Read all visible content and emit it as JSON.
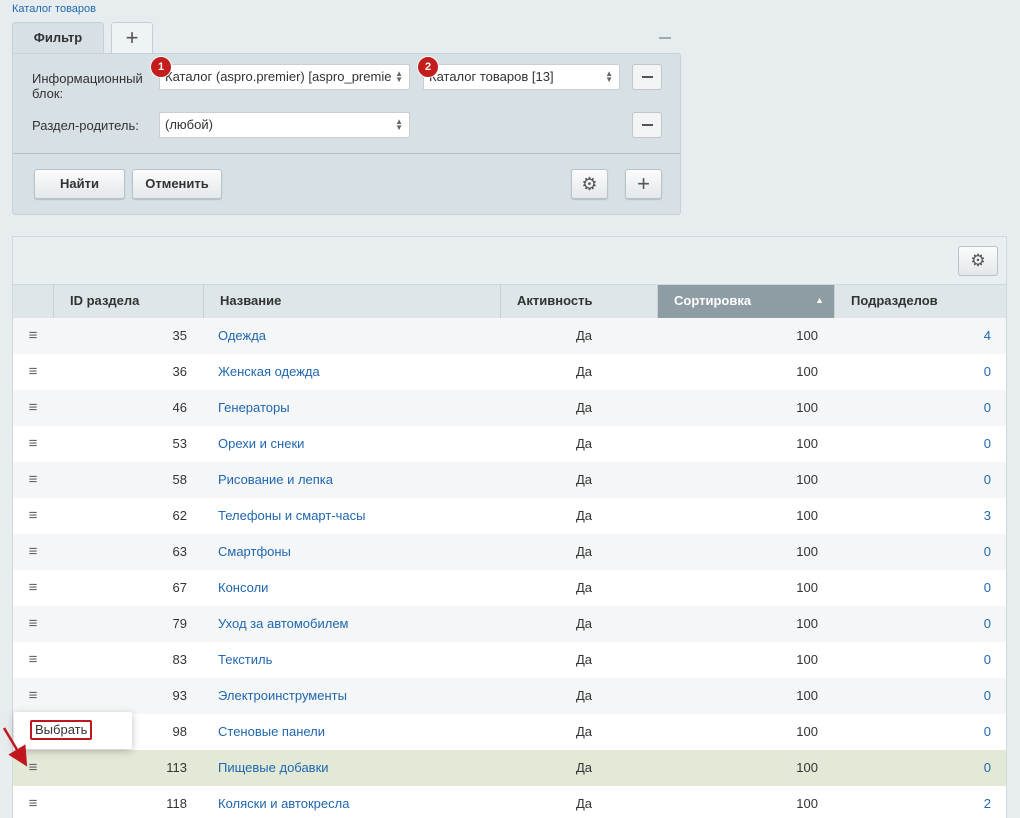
{
  "breadcrumb": "Каталог товаров",
  "filter": {
    "tab_label": "Фильтр",
    "add_tab_glyph": "+",
    "iblock_label": "Информационный блок:",
    "iblock_select_1": "Каталог (aspro.premier) [aspro_premie",
    "iblock_select_2": "Каталог товаров [13]",
    "parent_label": "Раздел-родитель:",
    "parent_select": "(любой)",
    "find_button": "Найти",
    "cancel_button": "Отменить",
    "settings_glyph": "⚙",
    "add_glyph": "+",
    "badge_1": "1",
    "badge_2": "2"
  },
  "grid": {
    "settings_glyph": "⚙",
    "columns": {
      "id": "ID раздела",
      "name": "Название",
      "active": "Активность",
      "sort": "Сортировка",
      "subsections": "Подразделов"
    },
    "sorted_column": "Сортировка",
    "sort_direction": "asc",
    "row_menu_glyph": "≡",
    "rows": [
      {
        "id": "35",
        "name": "Одежда",
        "active": "Да",
        "sort": "100",
        "sub": "4"
      },
      {
        "id": "36",
        "name": "Женская одежда",
        "active": "Да",
        "sort": "100",
        "sub": "0"
      },
      {
        "id": "46",
        "name": "Генераторы",
        "active": "Да",
        "sort": "100",
        "sub": "0"
      },
      {
        "id": "53",
        "name": "Орехи и снеки",
        "active": "Да",
        "sort": "100",
        "sub": "0"
      },
      {
        "id": "58",
        "name": "Рисование и лепка",
        "active": "Да",
        "sort": "100",
        "sub": "0"
      },
      {
        "id": "62",
        "name": "Телефоны и смарт-часы",
        "active": "Да",
        "sort": "100",
        "sub": "3"
      },
      {
        "id": "63",
        "name": "Смартфоны",
        "active": "Да",
        "sort": "100",
        "sub": "0"
      },
      {
        "id": "67",
        "name": "Консоли",
        "active": "Да",
        "sort": "100",
        "sub": "0"
      },
      {
        "id": "79",
        "name": "Уход за автомобилем",
        "active": "Да",
        "sort": "100",
        "sub": "0"
      },
      {
        "id": "83",
        "name": "Текстиль",
        "active": "Да",
        "sort": "100",
        "sub": "0"
      },
      {
        "id": "93",
        "name": "Электроинструменты",
        "active": "Да",
        "sort": "100",
        "sub": "0"
      },
      {
        "id": "98",
        "name": "Стеновые панели",
        "active": "Да",
        "sort": "100",
        "sub": "0"
      },
      {
        "id": "113",
        "name": "Пищевые добавки",
        "active": "Да",
        "sort": "100",
        "sub": "0"
      },
      {
        "id": "118",
        "name": "Коляски и автокресла",
        "active": "Да",
        "sort": "100",
        "sub": "2"
      }
    ],
    "highlighted_row_index": 12
  },
  "context_menu": {
    "select_label": "Выбрать"
  },
  "colors": {
    "link": "#2067b0",
    "annotation_red": "#c0161d",
    "highlight_row": "#e3e9d7"
  }
}
